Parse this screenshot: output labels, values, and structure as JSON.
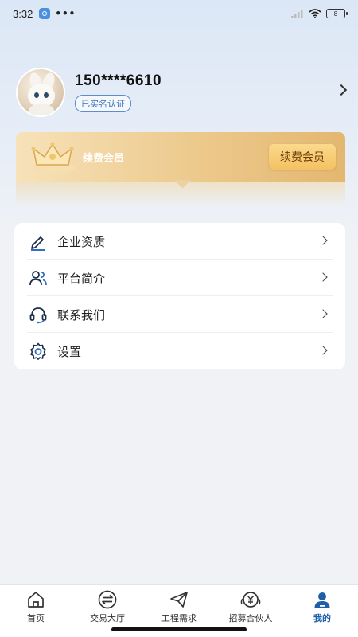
{
  "status_bar": {
    "time": "3:32",
    "dots": "•••",
    "battery": "8"
  },
  "profile": {
    "phone": "150****6610",
    "verify_badge": "已实名认证"
  },
  "membership": {
    "label": "续费会员",
    "button": "续费会员"
  },
  "menu": {
    "items": [
      {
        "label": "企业资质",
        "icon": "edit-pen-icon"
      },
      {
        "label": "平台简介",
        "icon": "users-icon"
      },
      {
        "label": "联系我们",
        "icon": "headset-icon"
      },
      {
        "label": "设置",
        "icon": "settings-gear-icon"
      }
    ]
  },
  "bottom_nav": {
    "items": [
      {
        "label": "首页",
        "icon": "home-icon"
      },
      {
        "label": "交易大厅",
        "icon": "exchange-icon"
      },
      {
        "label": "工程需求",
        "icon": "paper-plane-icon"
      },
      {
        "label": "招募合伙人",
        "icon": "yuan-partner-icon"
      },
      {
        "label": "我的",
        "icon": "profile-icon",
        "active": true
      }
    ]
  },
  "colors": {
    "accent": "#1f5fa8",
    "gold": "#e3b770",
    "badge": "#3a72b5"
  }
}
